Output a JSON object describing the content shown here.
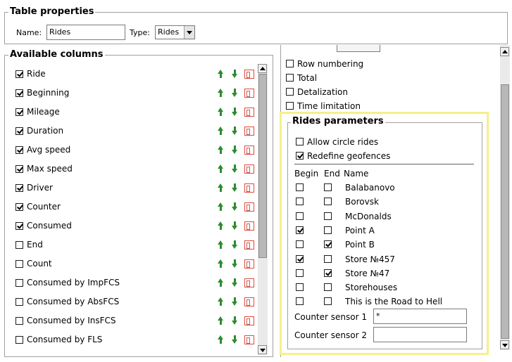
{
  "table_properties": {
    "legend": "Table properties",
    "name_label": "Name:",
    "name_value": "Rides",
    "type_label": "Type:",
    "type_value": "Rides"
  },
  "available_columns": {
    "legend": "Available columns",
    "items": [
      {
        "label": "Ride",
        "checked": true
      },
      {
        "label": "Beginning",
        "checked": true
      },
      {
        "label": "Mileage",
        "checked": true
      },
      {
        "label": "Duration",
        "checked": true
      },
      {
        "label": "Avg speed",
        "checked": true
      },
      {
        "label": "Max speed",
        "checked": true
      },
      {
        "label": "Driver",
        "checked": true
      },
      {
        "label": "Counter",
        "checked": true
      },
      {
        "label": "Consumed",
        "checked": true
      },
      {
        "label": "End",
        "checked": false
      },
      {
        "label": "Count",
        "checked": false
      },
      {
        "label": "Consumed by ImpFCS",
        "checked": false
      },
      {
        "label": "Consumed by AbsFCS",
        "checked": false
      },
      {
        "label": "Consumed by InsFCS",
        "checked": false
      },
      {
        "label": "Consumed by FLS",
        "checked": false
      }
    ]
  },
  "options": [
    {
      "label": "Row numbering",
      "checked": false
    },
    {
      "label": "Total",
      "checked": false
    },
    {
      "label": "Detalization",
      "checked": false
    },
    {
      "label": "Time limitation",
      "checked": false
    }
  ],
  "rides_parameters": {
    "legend": "Rides parameters",
    "allow_circle_rides": {
      "label": "Allow circle rides",
      "checked": false
    },
    "redefine_geofences": {
      "label": "Redefine geofences",
      "checked": true
    },
    "headers": {
      "begin": "Begin",
      "end": "End",
      "name": "Name"
    },
    "geofences": [
      {
        "name": "Balabanovo",
        "begin": false,
        "end": false
      },
      {
        "name": "Borovsk",
        "begin": false,
        "end": false
      },
      {
        "name": "McDonalds",
        "begin": false,
        "end": false
      },
      {
        "name": "Point A",
        "begin": true,
        "end": false
      },
      {
        "name": "Point B",
        "begin": false,
        "end": true
      },
      {
        "name": "Store №457",
        "begin": true,
        "end": false
      },
      {
        "name": "Store №47",
        "begin": false,
        "end": true
      },
      {
        "name": "Storehouses",
        "begin": false,
        "end": false
      },
      {
        "name": "This is the Road to Hell",
        "begin": false,
        "end": false
      }
    ],
    "counter_sensor_1": {
      "label": "Counter sensor 1",
      "value": "*"
    },
    "counter_sensor_2": {
      "label": "Counter sensor 2",
      "value": ""
    }
  },
  "colors": {
    "arrow_green": "#2e8b2e",
    "highlight_yellow": "#f5f08a",
    "icon_red": "#e04a3a"
  },
  "icons": [
    "move-up-icon",
    "move-down-icon",
    "column-properties-icon",
    "scroll-up-icon",
    "scroll-down-icon"
  ]
}
